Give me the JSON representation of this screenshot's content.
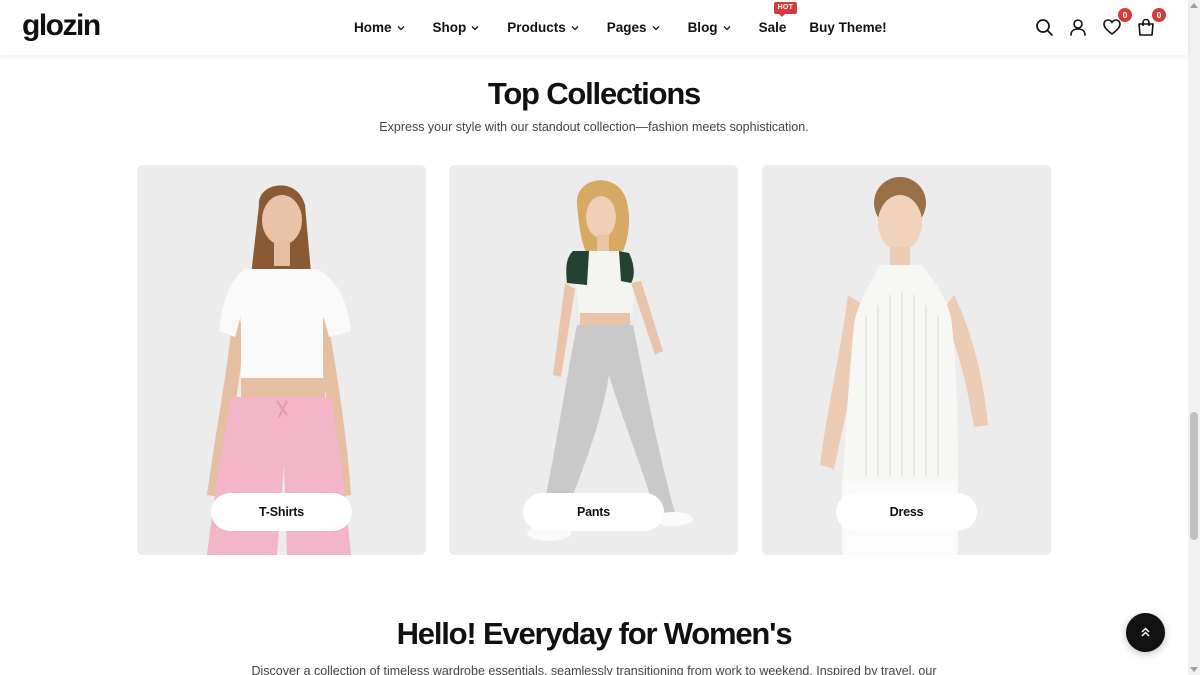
{
  "header": {
    "logo": "glozin",
    "nav": [
      {
        "label": "Home",
        "dropdown": true
      },
      {
        "label": "Shop",
        "dropdown": true
      },
      {
        "label": "Products",
        "dropdown": true
      },
      {
        "label": "Pages",
        "dropdown": true
      },
      {
        "label": "Blog",
        "dropdown": true
      },
      {
        "label": "Sale",
        "dropdown": false,
        "badge": "HOT"
      },
      {
        "label": "Buy Theme!",
        "dropdown": false
      }
    ],
    "icons": [
      "search-icon",
      "user-icon",
      "heart-icon",
      "bag-icon"
    ],
    "wishlist_count": "0",
    "cart_count": "0"
  },
  "collections": {
    "title": "Top Collections",
    "subtitle": "Express your style with our standout collection—fashion meets sophistication.",
    "cards": [
      {
        "label": "T-Shirts"
      },
      {
        "label": "Pants"
      },
      {
        "label": "Dress"
      }
    ]
  },
  "womens": {
    "title": "Hello! Everyday for Women's",
    "subtitle": "Discover a collection of timeless wardrobe essentials, seamlessly transitioning from work to weekend. Inspired by travel, our"
  },
  "colors": {
    "accent": "#d83a3a",
    "text": "#111111",
    "card_bg": "#ededed"
  }
}
